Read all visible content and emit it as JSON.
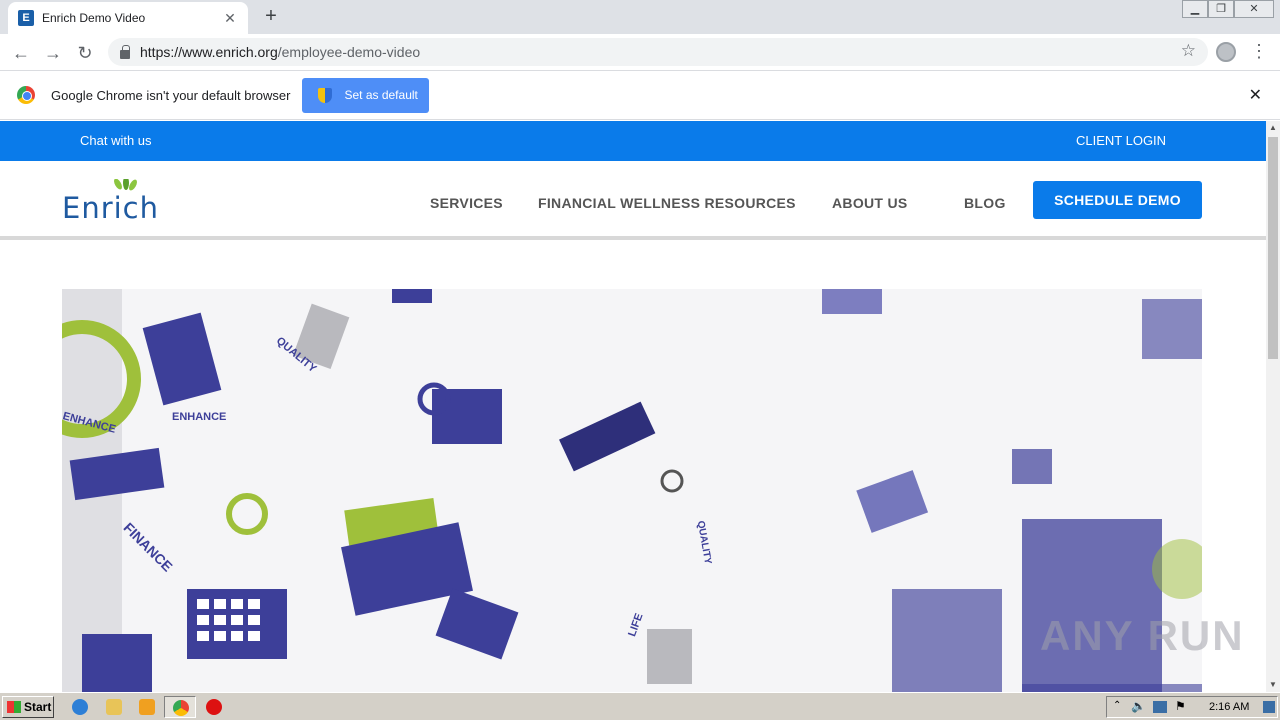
{
  "browser": {
    "tab_title": "Enrich Demo Video",
    "tab_favicon_letter": "E",
    "new_tab": "+",
    "url_host": "https://www.enrich.org",
    "url_path": "/employee-demo-video"
  },
  "infobar": {
    "message": "Google Chrome isn't your default browser",
    "button": "Set as default"
  },
  "site": {
    "chat": "Chat with us",
    "client_login": "CLIENT LOGIN",
    "logo": "Enrich",
    "nav": [
      "SERVICES",
      "FINANCIAL WELLNESS RESOURCES",
      "ABOUT US",
      "BLOG"
    ],
    "cta": "SCHEDULE DEMO"
  },
  "video": {
    "words": [
      "QUALITY",
      "ENHANCE",
      "ENHANCE",
      "FINANCE",
      "QUALITY",
      "LIFE"
    ],
    "colors": {
      "blue": "#3d3f99",
      "green": "#9fc03b",
      "gray": "#b9b9be"
    }
  },
  "taskbar": {
    "start": "Start",
    "clock": "2:16 AM"
  },
  "watermark": "ANY RUN",
  "colors": {
    "accent": "#0a7bea",
    "brand": "#1f5aa0"
  }
}
